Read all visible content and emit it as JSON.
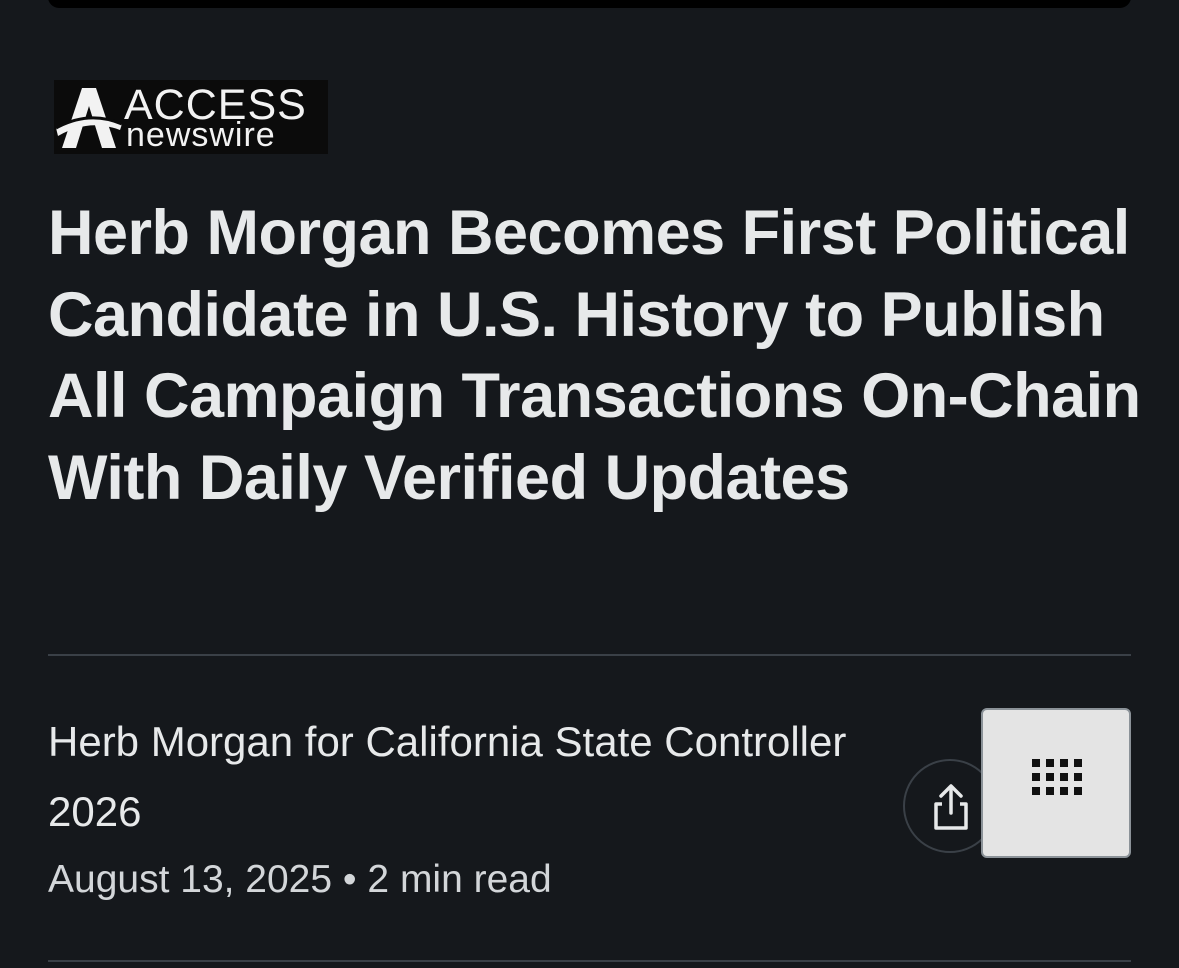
{
  "logo": {
    "brand": "ACCESS",
    "sub": "newswire",
    "icon": "access-a-logo-icon"
  },
  "article": {
    "headline": "Herb Morgan Becomes First Political Candidate in U.S. History to Publish All Campaign Transactions On-Chain With Daily Verified Updates",
    "author": "Herb Morgan for California State Controller 2026",
    "date": "August 13, 2025",
    "separator": "•",
    "read_time": "2 min read"
  },
  "actions": {
    "share_icon": "share-icon",
    "grid_icon": "grid-dots-icon"
  },
  "colors": {
    "background": "#15181c",
    "text": "#e7e9ea",
    "divider": "#3a4047",
    "grid_button_bg": "#e4e4e4"
  }
}
